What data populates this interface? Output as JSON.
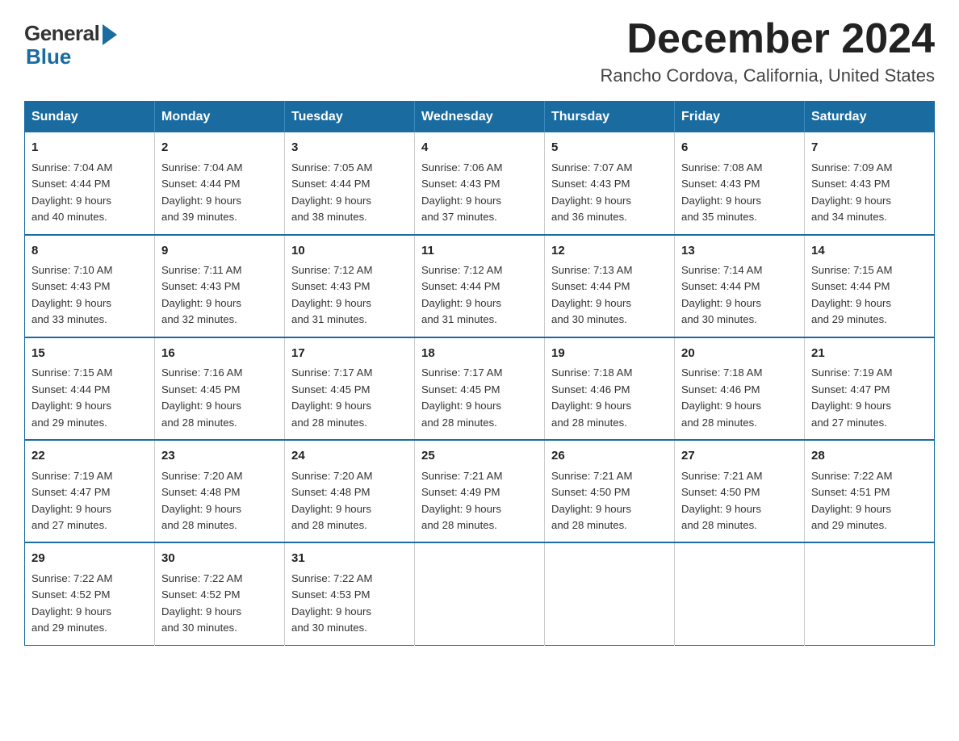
{
  "header": {
    "logo_general": "General",
    "logo_blue": "Blue",
    "month_title": "December 2024",
    "location": "Rancho Cordova, California, United States"
  },
  "calendar": {
    "days_of_week": [
      "Sunday",
      "Monday",
      "Tuesday",
      "Wednesday",
      "Thursday",
      "Friday",
      "Saturday"
    ],
    "weeks": [
      [
        {
          "day": "1",
          "sunrise": "7:04 AM",
          "sunset": "4:44 PM",
          "daylight": "9 hours and 40 minutes."
        },
        {
          "day": "2",
          "sunrise": "7:04 AM",
          "sunset": "4:44 PM",
          "daylight": "9 hours and 39 minutes."
        },
        {
          "day": "3",
          "sunrise": "7:05 AM",
          "sunset": "4:44 PM",
          "daylight": "9 hours and 38 minutes."
        },
        {
          "day": "4",
          "sunrise": "7:06 AM",
          "sunset": "4:43 PM",
          "daylight": "9 hours and 37 minutes."
        },
        {
          "day": "5",
          "sunrise": "7:07 AM",
          "sunset": "4:43 PM",
          "daylight": "9 hours and 36 minutes."
        },
        {
          "day": "6",
          "sunrise": "7:08 AM",
          "sunset": "4:43 PM",
          "daylight": "9 hours and 35 minutes."
        },
        {
          "day": "7",
          "sunrise": "7:09 AM",
          "sunset": "4:43 PM",
          "daylight": "9 hours and 34 minutes."
        }
      ],
      [
        {
          "day": "8",
          "sunrise": "7:10 AM",
          "sunset": "4:43 PM",
          "daylight": "9 hours and 33 minutes."
        },
        {
          "day": "9",
          "sunrise": "7:11 AM",
          "sunset": "4:43 PM",
          "daylight": "9 hours and 32 minutes."
        },
        {
          "day": "10",
          "sunrise": "7:12 AM",
          "sunset": "4:43 PM",
          "daylight": "9 hours and 31 minutes."
        },
        {
          "day": "11",
          "sunrise": "7:12 AM",
          "sunset": "4:44 PM",
          "daylight": "9 hours and 31 minutes."
        },
        {
          "day": "12",
          "sunrise": "7:13 AM",
          "sunset": "4:44 PM",
          "daylight": "9 hours and 30 minutes."
        },
        {
          "day": "13",
          "sunrise": "7:14 AM",
          "sunset": "4:44 PM",
          "daylight": "9 hours and 30 minutes."
        },
        {
          "day": "14",
          "sunrise": "7:15 AM",
          "sunset": "4:44 PM",
          "daylight": "9 hours and 29 minutes."
        }
      ],
      [
        {
          "day": "15",
          "sunrise": "7:15 AM",
          "sunset": "4:44 PM",
          "daylight": "9 hours and 29 minutes."
        },
        {
          "day": "16",
          "sunrise": "7:16 AM",
          "sunset": "4:45 PM",
          "daylight": "9 hours and 28 minutes."
        },
        {
          "day": "17",
          "sunrise": "7:17 AM",
          "sunset": "4:45 PM",
          "daylight": "9 hours and 28 minutes."
        },
        {
          "day": "18",
          "sunrise": "7:17 AM",
          "sunset": "4:45 PM",
          "daylight": "9 hours and 28 minutes."
        },
        {
          "day": "19",
          "sunrise": "7:18 AM",
          "sunset": "4:46 PM",
          "daylight": "9 hours and 28 minutes."
        },
        {
          "day": "20",
          "sunrise": "7:18 AM",
          "sunset": "4:46 PM",
          "daylight": "9 hours and 28 minutes."
        },
        {
          "day": "21",
          "sunrise": "7:19 AM",
          "sunset": "4:47 PM",
          "daylight": "9 hours and 27 minutes."
        }
      ],
      [
        {
          "day": "22",
          "sunrise": "7:19 AM",
          "sunset": "4:47 PM",
          "daylight": "9 hours and 27 minutes."
        },
        {
          "day": "23",
          "sunrise": "7:20 AM",
          "sunset": "4:48 PM",
          "daylight": "9 hours and 28 minutes."
        },
        {
          "day": "24",
          "sunrise": "7:20 AM",
          "sunset": "4:48 PM",
          "daylight": "9 hours and 28 minutes."
        },
        {
          "day": "25",
          "sunrise": "7:21 AM",
          "sunset": "4:49 PM",
          "daylight": "9 hours and 28 minutes."
        },
        {
          "day": "26",
          "sunrise": "7:21 AM",
          "sunset": "4:50 PM",
          "daylight": "9 hours and 28 minutes."
        },
        {
          "day": "27",
          "sunrise": "7:21 AM",
          "sunset": "4:50 PM",
          "daylight": "9 hours and 28 minutes."
        },
        {
          "day": "28",
          "sunrise": "7:22 AM",
          "sunset": "4:51 PM",
          "daylight": "9 hours and 29 minutes."
        }
      ],
      [
        {
          "day": "29",
          "sunrise": "7:22 AM",
          "sunset": "4:52 PM",
          "daylight": "9 hours and 29 minutes."
        },
        {
          "day": "30",
          "sunrise": "7:22 AM",
          "sunset": "4:52 PM",
          "daylight": "9 hours and 30 minutes."
        },
        {
          "day": "31",
          "sunrise": "7:22 AM",
          "sunset": "4:53 PM",
          "daylight": "9 hours and 30 minutes."
        },
        null,
        null,
        null,
        null
      ]
    ],
    "labels": {
      "sunrise": "Sunrise:",
      "sunset": "Sunset:",
      "daylight": "Daylight:"
    }
  }
}
